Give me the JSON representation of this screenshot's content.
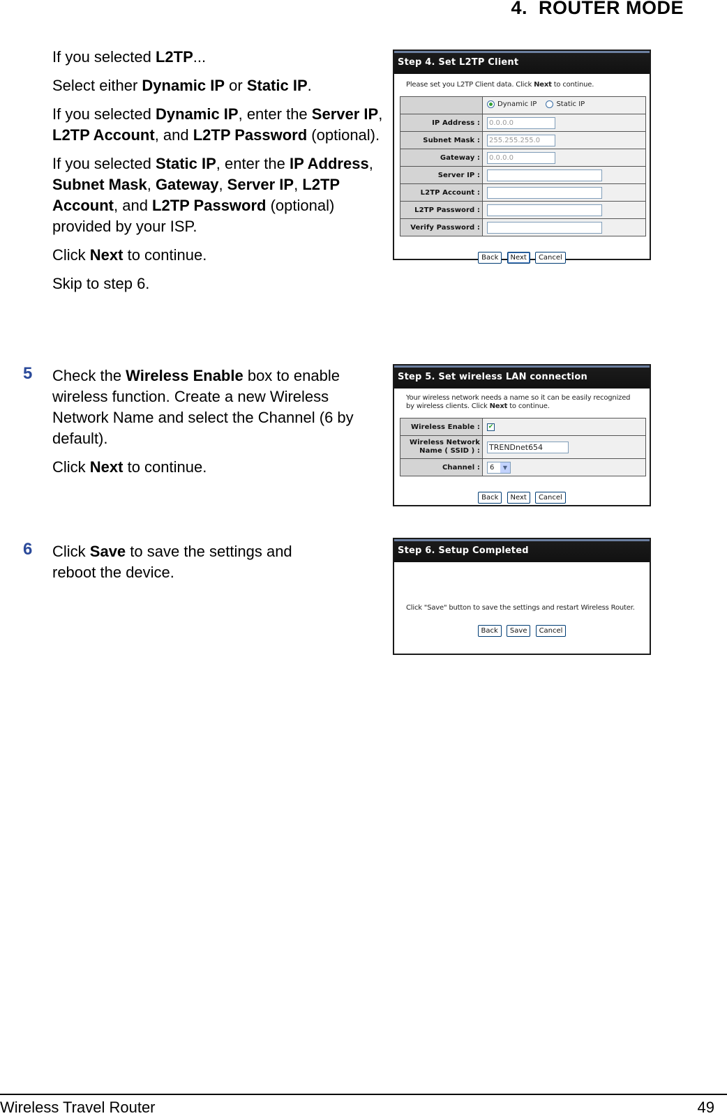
{
  "chapter_title": "4.  ROUTER MODE",
  "section_l2tp": {
    "p1": {
      "t1": "If you selected ",
      "b1": "L2TP",
      "t2": "..."
    },
    "p2": {
      "t1": "Select either ",
      "b1": "Dynamic IP",
      "t2": " or ",
      "b2": "Static IP",
      "t3": "."
    },
    "p3": {
      "t1": "If you selected ",
      "b1": "Dynamic IP",
      "t2": ", enter the ",
      "b2": "Server IP",
      "t3": ", ",
      "b3": "L2TP Account",
      "t4": ", and ",
      "b4": "L2TP Password",
      "t5": " (optional)."
    },
    "p4": {
      "t1": "If you selected ",
      "b1": "Static IP",
      "t2": ", enter the ",
      "b2": "IP Address",
      "t3": ", ",
      "b3": "Subnet Mask",
      "t4": ", ",
      "b4": "Gateway",
      "t5": ", ",
      "b5": "Server IP",
      "t6": ", ",
      "b6": "L2TP Account",
      "t7": ", and ",
      "b7": "L2TP Password",
      "t8": " (optional) provided by your ISP."
    },
    "p5": {
      "t1": "Click ",
      "b1": "Next",
      "t2": " to continue."
    },
    "p6": "Skip to step 6."
  },
  "step5": {
    "number": "5",
    "p1": {
      "t1": "Check the ",
      "b1": "Wireless Enable",
      "t2": " box to enable wireless function. Create a new Wireless Network Name and select the Channel (6 by default)."
    },
    "p2": {
      "t1": "Click ",
      "b1": "Next",
      "t2": " to continue."
    }
  },
  "step6": {
    "number": "6",
    "p1": {
      "t1": "Click ",
      "b1": "Save",
      "t2": " to save the settings and reboot the device."
    }
  },
  "panel_l2tp": {
    "title": "Step 4. Set L2TP Client",
    "desc_t1": "Please set you L2TP Client data. Click ",
    "desc_b1": "Next",
    "desc_t2": " to continue.",
    "radio_dynamic": "Dynamic IP",
    "radio_static": "Static IP",
    "selected_mode": "Dynamic IP",
    "fields": [
      {
        "label": "IP Address :",
        "value": "0.0.0.0"
      },
      {
        "label": "Subnet Mask :",
        "value": "255.255.255.0"
      },
      {
        "label": "Gateway :",
        "value": "0.0.0.0"
      },
      {
        "label": "Server IP :",
        "value": ""
      },
      {
        "label": "L2TP Account :",
        "value": ""
      },
      {
        "label": "L2TP Password :",
        "value": ""
      },
      {
        "label": "Verify Password :",
        "value": ""
      }
    ],
    "buttons": {
      "back": "Back",
      "next": "Next",
      "cancel": "Cancel"
    }
  },
  "panel_wireless": {
    "title": "Step 5. Set wireless LAN connection",
    "desc_t1": "Your wireless network needs a name so it can be easily recognized by wireless clients. Click ",
    "desc_b1": "Next",
    "desc_t2": " to continue.",
    "wireless_enable_label": "Wireless Enable :",
    "wireless_enable_checked": true,
    "check_mark": "✔",
    "ssid_label_1": "Wireless Network",
    "ssid_label_2": "Name ( SSID ) :",
    "ssid_value": "TRENDnet654",
    "channel_label": "Channel :",
    "channel_value": "6",
    "buttons": {
      "back": "Back",
      "next": "Next",
      "cancel": "Cancel"
    }
  },
  "panel_complete": {
    "title": "Step 6. Setup Completed",
    "message": "Click \"Save\" button to save the settings and restart Wireless Router.",
    "buttons": {
      "back": "Back",
      "save": "Save",
      "cancel": "Cancel"
    }
  },
  "footer": {
    "product": "Wireless Travel Router",
    "page_number": "49"
  }
}
